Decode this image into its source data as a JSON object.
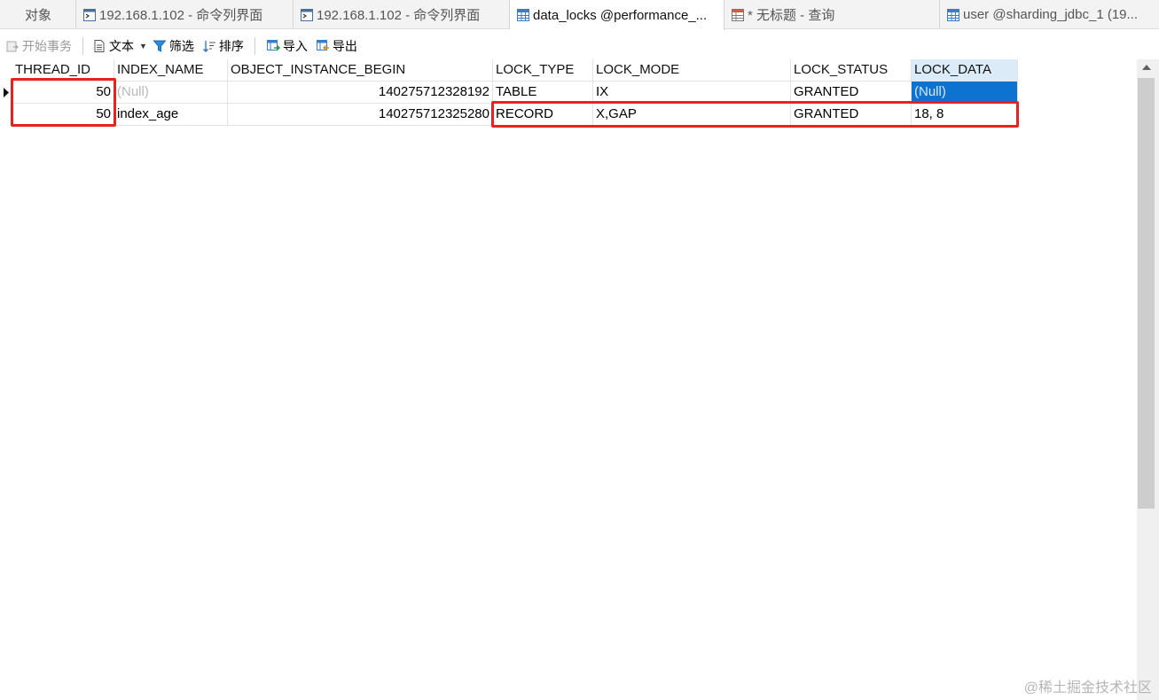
{
  "tabs": [
    {
      "label": "对象",
      "icon": "none",
      "active": false
    },
    {
      "label": "192.168.1.102 - 命令列界面",
      "icon": "console-icon",
      "active": false
    },
    {
      "label": "192.168.1.102 - 命令列界面",
      "icon": "console-icon",
      "active": false
    },
    {
      "label": "data_locks @performance_...",
      "icon": "table-icon",
      "active": true
    },
    {
      "label": "* 无标题 - 查询",
      "icon": "query-icon",
      "active": false
    },
    {
      "label": "user @sharding_jdbc_1 (19...",
      "icon": "table-icon",
      "active": false
    }
  ],
  "toolbar": {
    "begin_transaction": "开始事务",
    "text": "文本",
    "filter": "筛选",
    "sort": "排序",
    "import": "导入",
    "export": "导出"
  },
  "grid": {
    "columns": [
      "THREAD_ID",
      "INDEX_NAME",
      "OBJECT_INSTANCE_BEGIN",
      "LOCK_TYPE",
      "LOCK_MODE",
      "LOCK_STATUS",
      "LOCK_DATA"
    ],
    "rows": [
      [
        "50",
        "(Null)",
        "140275712328192",
        "TABLE",
        "IX",
        "GRANTED",
        "(Null)"
      ],
      [
        "50",
        "index_age",
        "140275712325280",
        "RECORD",
        "X,GAP",
        "GRANTED",
        "18, 8"
      ]
    ]
  },
  "colors": {
    "highlight": "#e8231f",
    "selection": "#0e73d0",
    "sorted_header": "#dcebf8"
  },
  "watermark": "@稀土掘金技术社区"
}
